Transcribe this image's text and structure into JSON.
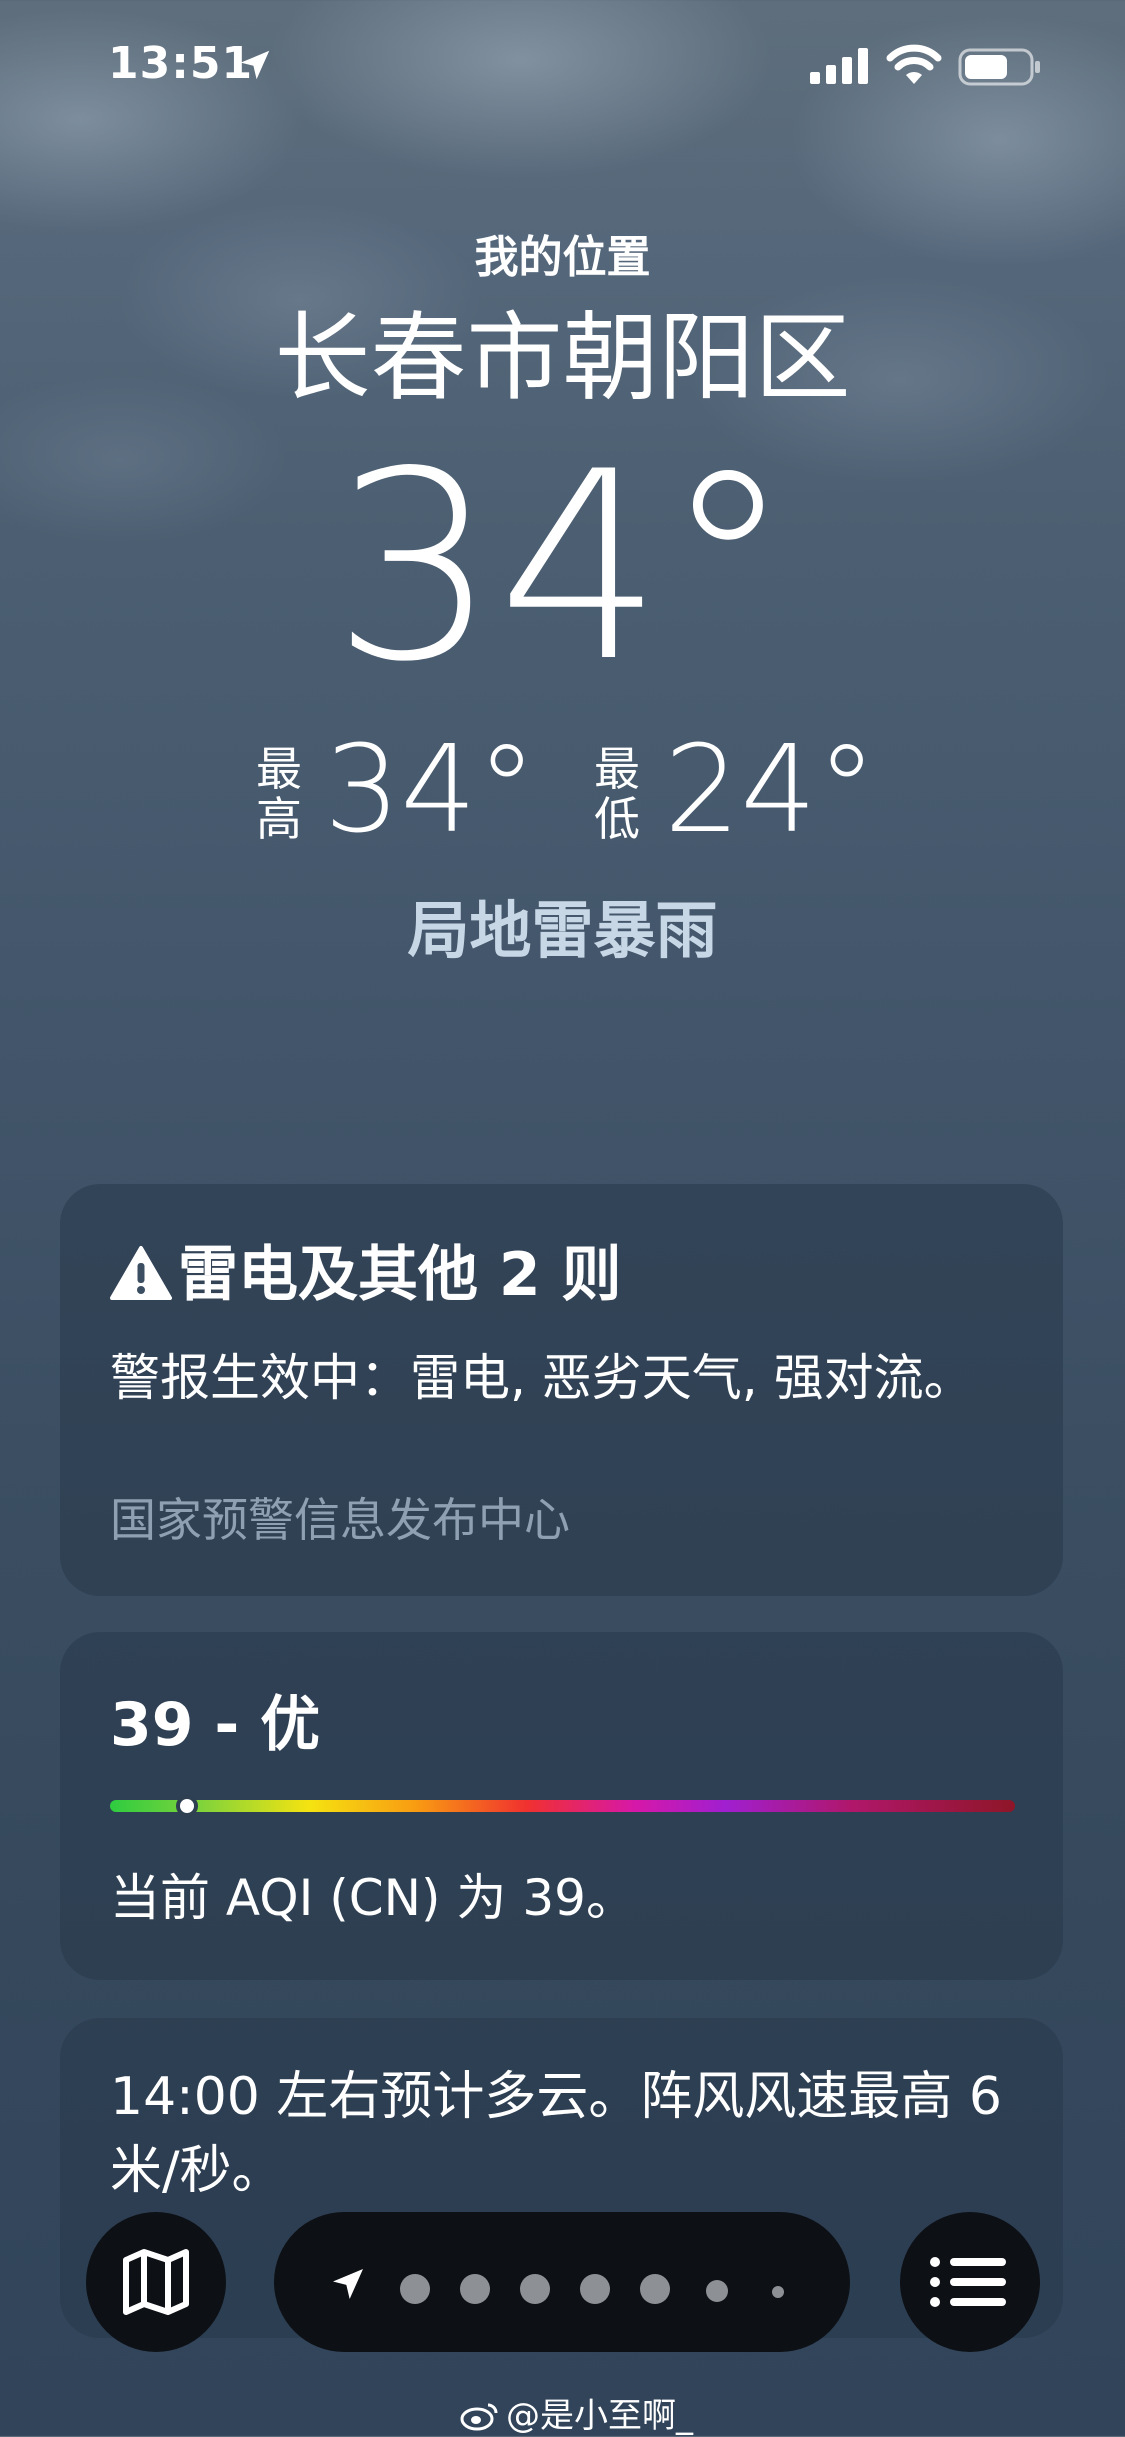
{
  "status_bar": {
    "time": "13:51"
  },
  "header": {
    "my_location": "我的位置",
    "city": "长春市朝阳区",
    "temperature": "34°",
    "high_label": "最高",
    "high_value": "34°",
    "low_label": "最低",
    "low_value": "24°",
    "condition": "局地雷暴雨"
  },
  "alert_card": {
    "title": "雷电及其他 2 则",
    "body": "警报生效中：雷电, 恶劣天气, 强对流。",
    "source": "国家预警信息发布中心"
  },
  "aqi_card": {
    "title": "39 - 优",
    "aqi_level_fraction": 0.085,
    "description": "当前 AQI (CN) 为 39。"
  },
  "forecast_card": {
    "text": "14:00 左右预计多云。阵风风速最高 6 米/秒。"
  },
  "bottom_bar": {
    "page_count": 7,
    "current_page": "location"
  },
  "watermark": {
    "text": "@是小至啊_"
  },
  "colors": {
    "condition_text": "#c8d7e6",
    "source_text": "#8ea0b2",
    "button_bg": "#0d1015"
  }
}
